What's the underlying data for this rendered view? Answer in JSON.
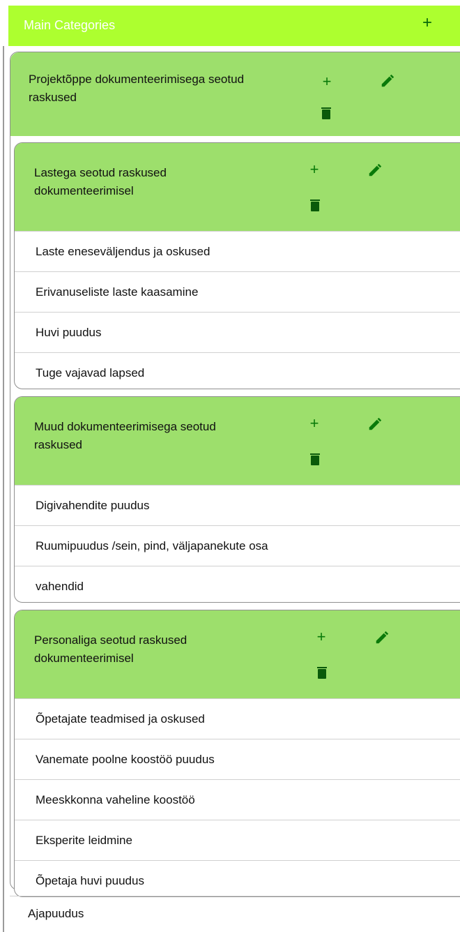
{
  "header": {
    "title": "Main Categories",
    "add_icon": "plus-icon"
  },
  "main_category": {
    "label_line1": "Projektõppe dokumenteerimisega seotud",
    "label_line2": "raskused"
  },
  "groups": [
    {
      "label_line1": "Lastega seotud raskused",
      "label_line2": "dokumenteerimisel",
      "items": [
        "Laste eneseväljendus ja oskused",
        "Erivanuseliste laste kaasamine",
        "Huvi puudus",
        "Tuge vajavad lapsed"
      ]
    },
    {
      "label_line1": "Muud dokumenteerimisega seotud",
      "label_line2": "raskused",
      "items": [
        "Digivahendite puudus",
        "Ruumipuudus /sein, pind, väljapanekute osa",
        "vahendid"
      ]
    },
    {
      "label_line1": "Personaliga seotud raskused",
      "label_line2": "dokumenteerimisel",
      "items": [
        "Õpetajate teadmised ja oskused",
        "Vanemate poolne koostöö puudus",
        "Meeskkonna vaheline koostöö",
        "Eksperite leidmine",
        "Õpetaja huvi puudus"
      ]
    }
  ],
  "bottom_item": "Ajapuudus",
  "icons": {
    "add": "+",
    "edit": "pencil-icon",
    "delete": "trash-icon"
  },
  "colors": {
    "topbar": "#adff2f",
    "header_green": "#9ddf6c",
    "icon_green": "#0a7a0a"
  }
}
